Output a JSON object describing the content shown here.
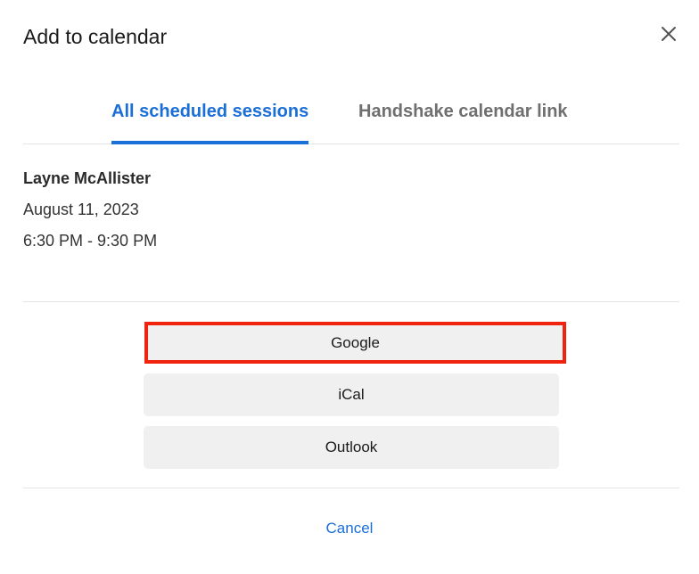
{
  "dialog": {
    "title": "Add to calendar",
    "close_icon": "close-icon"
  },
  "tabs": [
    {
      "label": "All scheduled sessions",
      "active": true
    },
    {
      "label": "Handshake calendar link",
      "active": false
    }
  ],
  "session": {
    "name": "Layne McAllister",
    "date": "August 11, 2023",
    "time": "6:30 PM - 9:30 PM"
  },
  "calendar_options": [
    {
      "label": "Google",
      "highlighted": true
    },
    {
      "label": "iCal",
      "highlighted": false
    },
    {
      "label": "Outlook",
      "highlighted": false
    }
  ],
  "footer": {
    "cancel_label": "Cancel"
  },
  "colors": {
    "accent": "#1a6ed8",
    "highlight_border": "#f0230f",
    "button_bg": "#f0f0f0",
    "divider": "#e3e3e3"
  }
}
